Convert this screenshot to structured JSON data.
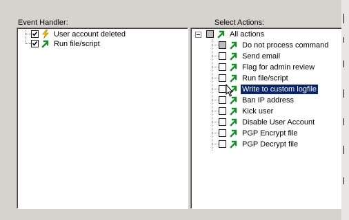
{
  "left_panel": {
    "label": "Event Handler:",
    "items": [
      {
        "label": "User account deleted",
        "checked": true,
        "icon": "lightning-icon"
      },
      {
        "label": "Run file/script",
        "checked": true,
        "icon": "green-arrow-icon"
      }
    ]
  },
  "right_panel": {
    "label": "Select Actions:",
    "root": {
      "label": "All actions",
      "state": "partial"
    },
    "items": [
      {
        "label": "Do not process command",
        "state": "partial"
      },
      {
        "label": "Send email",
        "state": "unchecked"
      },
      {
        "label": "Flag for admin review",
        "state": "unchecked"
      },
      {
        "label": "Run file/script",
        "state": "unchecked"
      },
      {
        "label": "Write to custom logfile",
        "state": "unchecked",
        "selected": true
      },
      {
        "label": "Ban IP address",
        "state": "unchecked"
      },
      {
        "label": "Kick user",
        "state": "unchecked"
      },
      {
        "label": "Disable User Account",
        "state": "unchecked"
      },
      {
        "label": "PGP Encrypt file",
        "state": "unchecked"
      },
      {
        "label": "PGP Decrypt file",
        "state": "unchecked"
      }
    ]
  },
  "colors": {
    "selection": "#0a246a",
    "arrow": "#1a8a2a",
    "lightning": "#f0c000",
    "window_bg": "#d6d3ce"
  }
}
